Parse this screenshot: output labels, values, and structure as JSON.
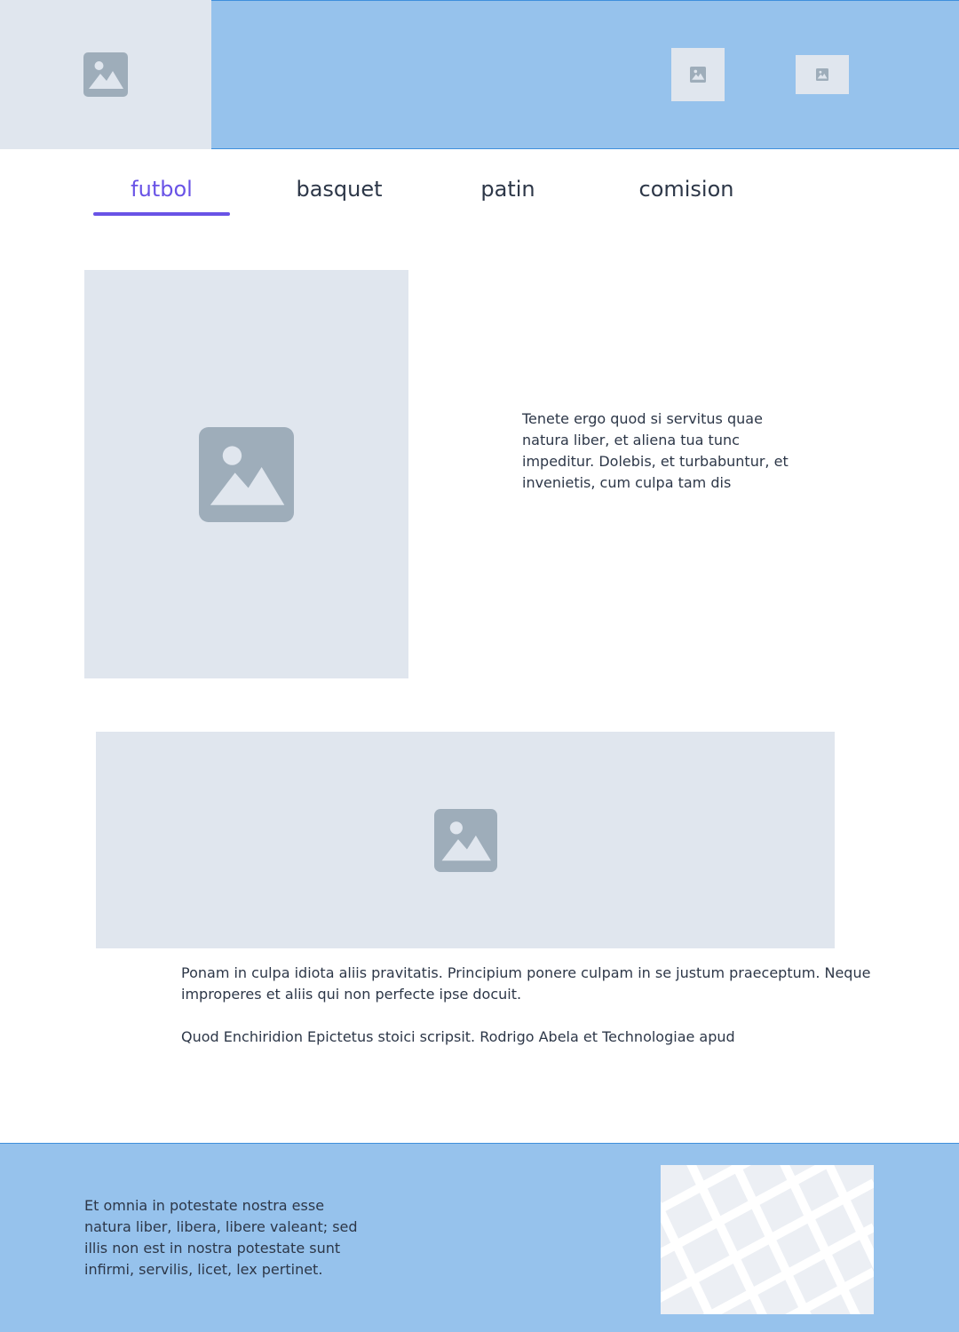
{
  "header": {
    "logo_icon": "image-placeholder-icon",
    "image1_icon": "image-placeholder-icon",
    "image2_icon": "image-placeholder-icon"
  },
  "tabs": [
    {
      "label": "futbol",
      "active": true
    },
    {
      "label": "basquet",
      "active": false
    },
    {
      "label": "patin",
      "active": false
    },
    {
      "label": "comision",
      "active": false
    }
  ],
  "section1": {
    "image_icon": "image-placeholder-icon",
    "text": "Tenete ergo quod si servitus quae natura liber, et aliena tua tunc impeditur. Dolebis, et turbabuntur, et invenietis, cum culpa tam dis"
  },
  "section2": {
    "image_icon": "image-placeholder-icon",
    "paragraph1": "Ponam in culpa idiota aliis pravitatis. Principium ponere culpam in se justum praeceptum. Neque improperes et aliis qui non perfecte ipse docuit.",
    "paragraph2": "Quod Enchiridion Epictetus stoici scripsit. Rodrigo Abela et Technologiae apud"
  },
  "footer": {
    "text": "Et omnia in potestate nostra esse natura liber, libera, libere valeant; sed illis non est in nostra potestate sunt infirmi, servilis, licet, lex pertinet.",
    "map_icon": "map-placeholder-icon"
  },
  "colors": {
    "header_bg": "#96c2ec",
    "accent": "#6953e6",
    "placeholder_bg": "#e0e6ee",
    "placeholder_icon": "#9eadba"
  }
}
